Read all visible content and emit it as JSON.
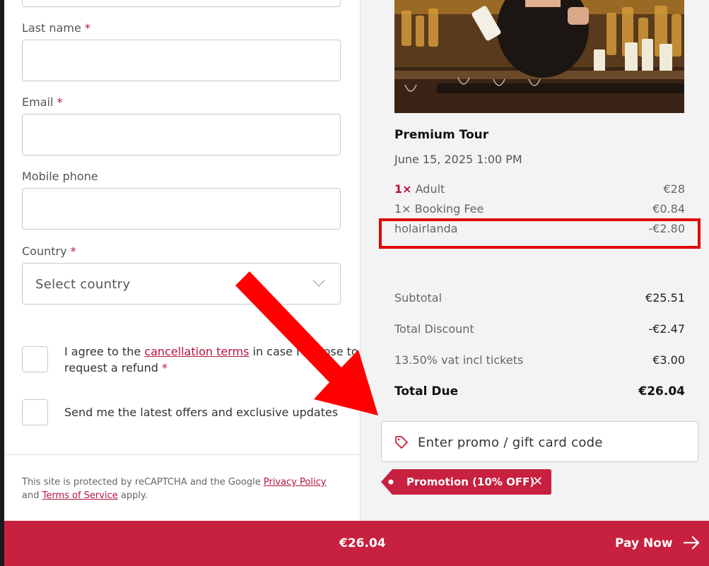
{
  "form": {
    "last_name_label": "Last name",
    "email_label": "Email",
    "mobile_label": "Mobile phone",
    "country_label": "Country",
    "required_marker": "*",
    "country_placeholder": "Select country",
    "agree_prefix": "I agree to the ",
    "agree_link": "cancellation terms",
    "agree_suffix": " in case I choose to",
    "agree_line2": "request a refund ",
    "offers_label": "Send me the latest offers and exclusive updates",
    "recaptcha_prefix": "This site is protected by reCAPTCHA and the Google ",
    "privacy_link": "Privacy Policy",
    "recaptcha_and": "and ",
    "terms_link": "Terms of Service",
    "recaptcha_suffix": " apply."
  },
  "order": {
    "tour_title": "Premium Tour",
    "tour_date": "June 15, 2025 1:00 PM",
    "items": [
      {
        "qty": "1×",
        "label": " Adult",
        "amount": "€28"
      },
      {
        "qty": "1×",
        "label": " Booking Fee",
        "amount": "€0.84"
      },
      {
        "qty": "",
        "label": "holairlanda",
        "amount": "-€2.80"
      }
    ],
    "summary": [
      {
        "label": "Subtotal",
        "amount": "€25.51"
      },
      {
        "label": "Total Discount",
        "amount": "-€2.47"
      },
      {
        "label": "13.50% vat incl tickets",
        "amount": "€3.00"
      },
      {
        "label": "Total Due",
        "amount": "€26.04"
      }
    ],
    "promo_placeholder": "Enter promo / gift card code",
    "promo_badge": "Promotion (10% OFF)",
    "promo_close": "✕"
  },
  "footer": {
    "amount": "€26.04",
    "pay_label": "Pay Now"
  },
  "colors": {
    "accent": "#c8203f",
    "annotation": "#e00000"
  },
  "icons": [
    "tag-icon",
    "chevron-down-icon",
    "arrow-right-icon",
    "close-icon"
  ]
}
